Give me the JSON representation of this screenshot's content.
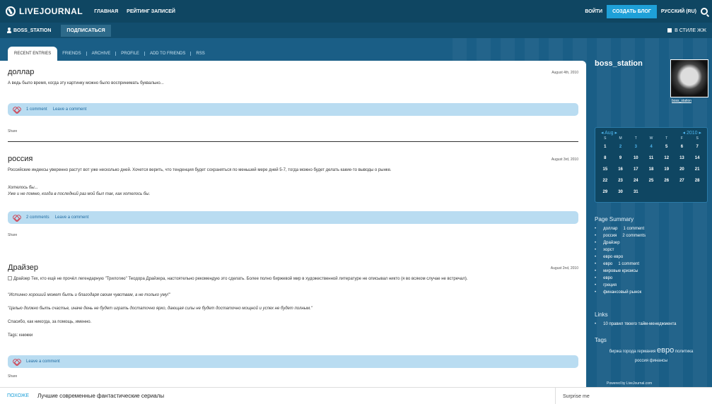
{
  "topbar": {
    "brand": "LIVEJOURNAL",
    "nav": [
      "ГЛАВНАЯ",
      "РЕЙТИНГ ЗАПИСЕЙ"
    ],
    "login": "ВОЙТИ",
    "create": "СОЗДАТЬ БЛОГ",
    "lang": "РУССКИЙ (RU)"
  },
  "journal": {
    "username": "BOSS_STATION",
    "subscribe": "ПОДПИСАТЬСЯ",
    "style_toggle": "В СТИЛЕ ЖЖ"
  },
  "tabs": [
    "RECENT ENTRIES",
    "FRIENDS",
    "ARCHIVE",
    "PROFILE",
    "ADD TO FRIENDS",
    "RSS"
  ],
  "entries": [
    {
      "title": "доллар",
      "date": "August 4th, 2010",
      "text": "А ведь было время, когда эту картинку можно было воспринимать буквально...",
      "links": [
        "1 comment",
        "Leave a comment"
      ],
      "share": "Share"
    },
    {
      "title": "россия",
      "date": "August 3rd, 2010",
      "text": "Российские индексы уверенно растут вот уже несколько дней. Хочется верить, что тенденция будет сохраняться по меньшей мере дней 5-7, тогда можно будет делать какие-то выводы о рынке.",
      "italic1": "Хотелось бы...",
      "italic2": "Уже и не помню, когда в последний раз мой был так, как хотелось бы.",
      "links": [
        "2 comments",
        "Leave a comment"
      ],
      "share": "Share"
    },
    {
      "title": "Драйзер",
      "date": "August 2nd, 2010",
      "text": "Драйзер Тех, кто ещё не прочёл легендарную \"Трилогию\" Теодора Драйзера, настоятельно рекомендую это сделать. Более полно биржевой мир в художественной литературе не описывал никто (я во всяком случае не встречал).",
      "quote1": "\"Истинно хороший может быть и благодаря своим чувствам, а не только уму!\"",
      "quote2": "\"Целью должно быть счастье, иначе день не будет играть достаточно ярко, дающая силы не будет достаточно мощной и успех не будет полным.\"",
      "note": "Спасибо, как никогда, за помощь, именно.",
      "tags_line": "Tags: книжки",
      "links": [
        "Leave a comment"
      ],
      "share": "Share"
    }
  ],
  "sidebar": {
    "title": "boss_station",
    "avatar_name": "boss_station",
    "calendar": {
      "month": "Aug",
      "year": "2010",
      "dow": [
        "S",
        "M",
        "T",
        "W",
        "T",
        "F",
        "S"
      ],
      "days": [
        "1",
        "2",
        "3",
        "4",
        "5",
        "6",
        "7",
        "8",
        "9",
        "10",
        "11",
        "12",
        "13",
        "14",
        "15",
        "16",
        "17",
        "18",
        "19",
        "20",
        "21",
        "22",
        "23",
        "24",
        "25",
        "26",
        "27",
        "28",
        "29",
        "30",
        "31"
      ]
    },
    "summary_head": "Page Summary",
    "summary": [
      {
        "title": "доллар",
        "comments": "1 comment"
      },
      {
        "title": "россия",
        "comments": "2 comments"
      },
      {
        "title": "Драйзер",
        "comments": ""
      },
      {
        "title": "хорст",
        "comments": ""
      },
      {
        "title": "евро евро",
        "comments": ""
      },
      {
        "title": "евро",
        "comments": "1 comment"
      },
      {
        "title": "мировые кризисы",
        "comments": ""
      },
      {
        "title": "евро",
        "comments": ""
      },
      {
        "title": "греция",
        "comments": ""
      },
      {
        "title": "финансовый рынок",
        "comments": ""
      }
    ],
    "links_head": "Links",
    "links": [
      "10 правил твоего тайм-менеджмента"
    ],
    "tags_head": "Tags",
    "tags_line1": "биржа города германия",
    "tags_big": "евро",
    "tags_line1b": "политика",
    "tags_line2": "россия финансы",
    "powered": "Powered by LiveJournal.com"
  },
  "bottom": {
    "label": "ПОХОЖЕ",
    "title": "Лучшие современные фантастические сериалы",
    "surprise": "Surprise me"
  }
}
